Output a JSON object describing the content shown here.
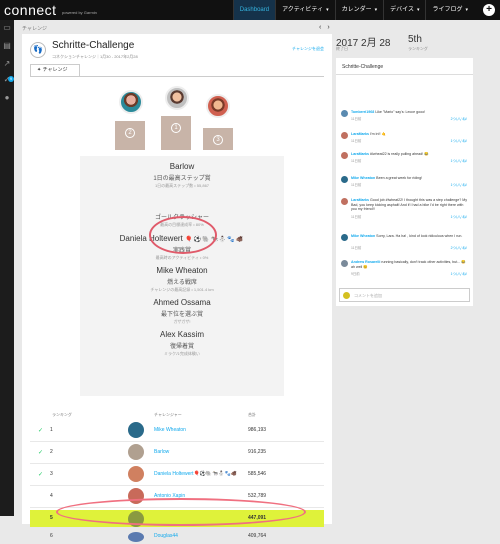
{
  "app": {
    "logo": "connect",
    "logo_sub": "powered by Garmin"
  },
  "nav": {
    "items": [
      "Dashboard",
      "アクティビティ",
      "カレンダー",
      "デバイス",
      "ライフログ"
    ],
    "plus": "+"
  },
  "sidebar": {
    "badge": "9"
  },
  "breadcrumb": "チャレンジ",
  "challenge": {
    "title": "Schritte-Challenge",
    "subtitle": "コネクションチャレンジ｜1月30 - 2017年2月28",
    "leave_link": "チャレンジを退会",
    "tab_label": "チャレンジ"
  },
  "podium": [
    "2",
    "1",
    "3"
  ],
  "awards": [
    {
      "name": "Barlow",
      "title": "1日の最高ステップ賞",
      "desc": "1日の最高ステップ数 • 55,867"
    },
    {
      "name": "",
      "title": "ゴールクラッシャー",
      "desc": "最高の目標達成率 • 80%"
    },
    {
      "name": "Daniela Holtewert",
      "emojis": "🎈⚽🐘🐄⛄🐾🐗",
      "title": "実践賞",
      "desc": "最高時のアクティビティ • 0%"
    },
    {
      "name": "Mike Wheaton",
      "title": "燃える戦席",
      "desc": "チャレンジの最高記録 • 1,501.4 km"
    },
    {
      "name": "Ahmed Ossama",
      "title": "最下位を選ぶ賞",
      "desc": "ガザガザ!"
    },
    {
      "name": "Alex Kassim",
      "title": "復帰着賞",
      "desc": "ミラクル完成体験い"
    }
  ],
  "ranking": {
    "headers": {
      "rank": "ランキング",
      "challenger": "チャレンジャー",
      "total": "合計"
    },
    "rows": [
      {
        "rank": "1",
        "check": "✓",
        "name": "Mike Wheaton",
        "value": "986,193"
      },
      {
        "rank": "2",
        "check": "✓",
        "name": "Barlow",
        "value": "916,235"
      },
      {
        "rank": "3",
        "check": "✓",
        "name": "Daniela Holtewert🎈⚽🐘🐄⛄🐾🐗",
        "value": "585,546"
      },
      {
        "rank": "4",
        "check": "",
        "name": "Antonio Xapin",
        "value": "532,789"
      },
      {
        "rank": "5",
        "check": "",
        "name": "",
        "value": "447,091"
      },
      {
        "rank": "6",
        "check": "",
        "name": "Douglas44",
        "value": "409,764"
      }
    ]
  },
  "summary": {
    "date": "2017 2月 28",
    "date_label": "終了日",
    "rank": "5th",
    "rank_label": "ランキング"
  },
  "feed": {
    "title": "Schritte-Challenge",
    "messages": [
      {
        "user": "Tomberri1968",
        "text": "Like \"Mario\" say's: Lecce gooo!",
        "time": "11日前",
        "likes": "2ついいね!"
      },
      {
        "user": "LaraMarks",
        "text": "I'm in!! 🤙",
        "time": "11日前",
        "likes": "1ついいね!"
      },
      {
        "user": "LaraMarks",
        "text": "#Iwheat22 is really pulling ahead! 😂",
        "time": "11日前",
        "likes": "1ついいね!"
      },
      {
        "user": "Mike Wheaton",
        "text": "Been a great week for riding!",
        "time": "11日前",
        "likes": "1ついいね!"
      },
      {
        "user": "LaraMarks",
        "text": "Good job #Iwheat22! I thought this was a step challenge? My Bad, you keep kicking asphalt! And if I had a bike I'd be right there with you my friend!!",
        "time": "11日前",
        "likes": "1ついいね!"
      },
      {
        "user": "Mike Wheaton",
        "text": "Sorry, Lara. Ha ha! , kind of look ridiculous when I run.",
        "time": "11日前",
        "likes": "2ついいね!"
      },
      {
        "user": "Andrew Rosarelli",
        "text": "running basically, don't track other activities, but... 😂 ah well 😊",
        "time": "9日前",
        "likes": "1ついいね!"
      }
    ],
    "comment_placeholder": "コメントを追加"
  }
}
